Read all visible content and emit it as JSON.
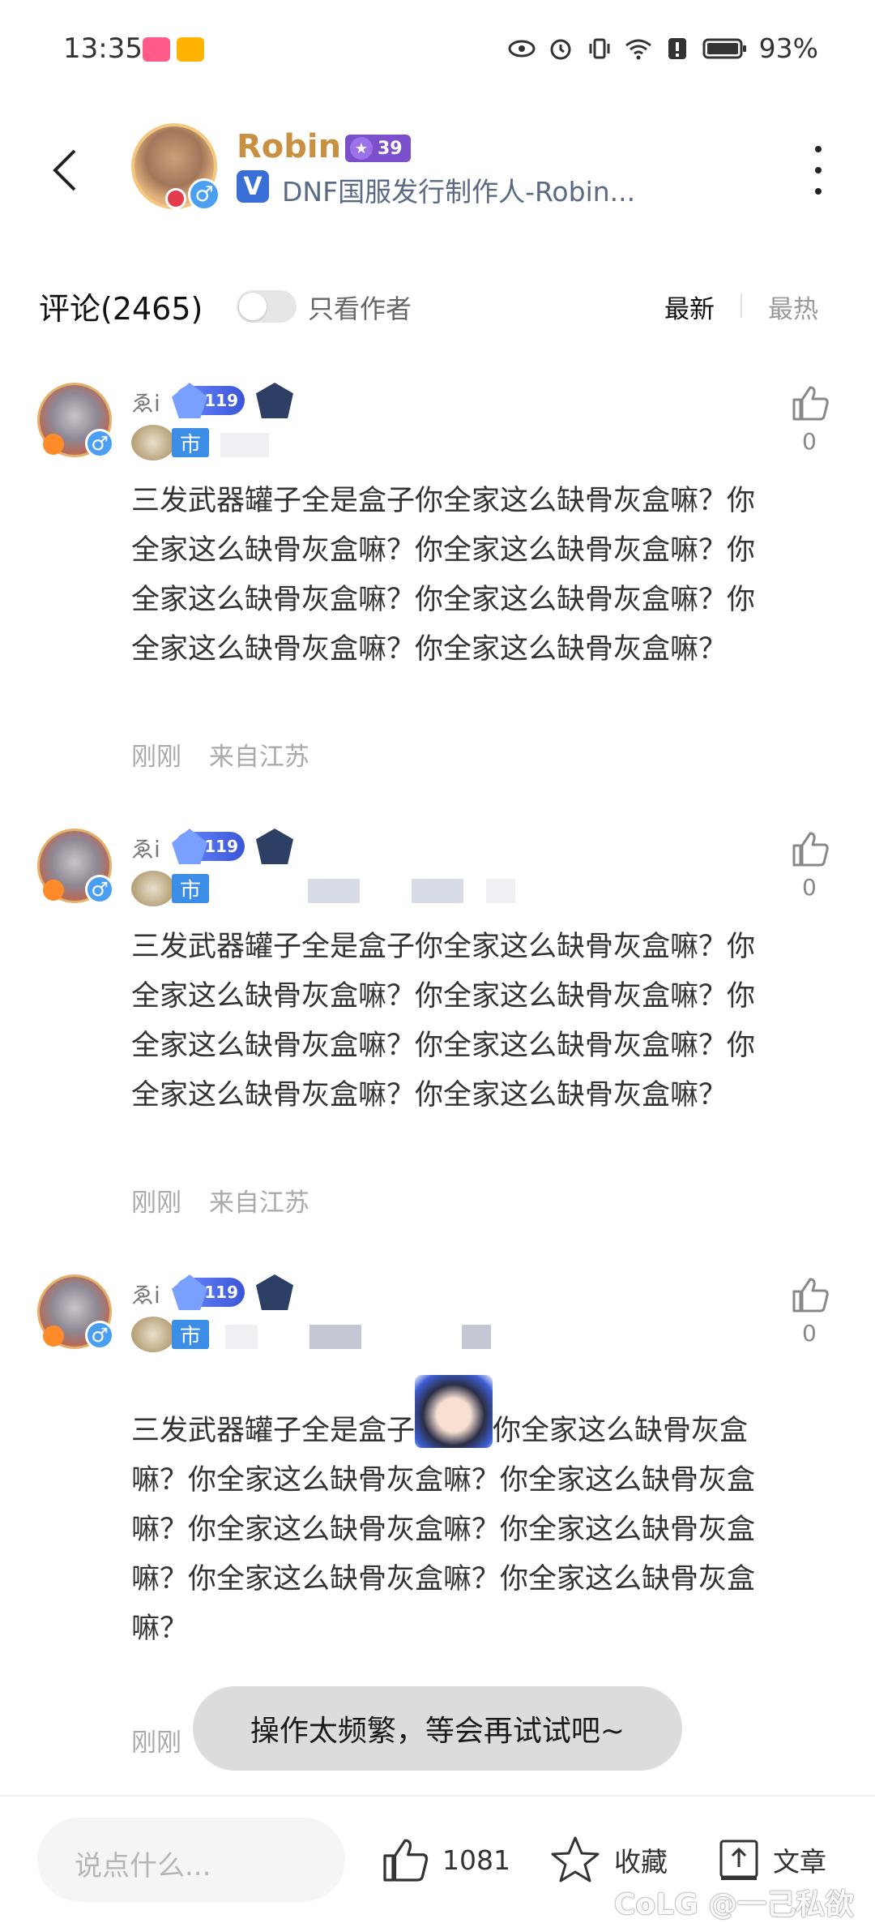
{
  "status_bar": {
    "time": "13:35",
    "battery": "93%",
    "icons": [
      "eye-icon",
      "alarm-icon",
      "vibrate-icon",
      "wifi-icon",
      "alert-icon",
      "battery-icon"
    ]
  },
  "header": {
    "author_name": "Robin",
    "author_level": "39",
    "verified_badge": "V",
    "author_title": "DNF国服发行制作人-Robin..."
  },
  "comments_bar": {
    "title": "评论(2465)",
    "only_author_label": "只看作者",
    "sort_newest": "最新",
    "sort_hottest": "最热"
  },
  "comments": [
    {
      "username": "ゑi",
      "level": "119",
      "city_tag": "市",
      "like_count": "0",
      "text": "三发武器罐子全是盒子你全家这么缺骨灰盒嘛？你全家这么缺骨灰盒嘛？你全家这么缺骨灰盒嘛？你全家这么缺骨灰盒嘛？你全家这么缺骨灰盒嘛？你全家这么缺骨灰盒嘛？你全家这么缺骨灰盒嘛？",
      "time": "刚刚",
      "location": "来自江苏"
    },
    {
      "username": "ゑi",
      "level": "119",
      "city_tag": "市",
      "like_count": "0",
      "text": "三发武器罐子全是盒子你全家这么缺骨灰盒嘛？你全家这么缺骨灰盒嘛？你全家这么缺骨灰盒嘛？你全家这么缺骨灰盒嘛？你全家这么缺骨灰盒嘛？你全家这么缺骨灰盒嘛？你全家这么缺骨灰盒嘛？",
      "time": "刚刚",
      "location": "来自江苏"
    },
    {
      "username": "ゑi",
      "level": "119",
      "city_tag": "市",
      "like_count": "0",
      "text_before": "三发武器罐子全是盒子",
      "text_after": "你全家这么缺骨灰盒嘛？你全家这么缺骨灰盒嘛？你全家这么缺骨灰盒嘛？你全家这么缺骨灰盒嘛？你全家这么缺骨灰盒嘛？你全家这么缺骨灰盒嘛？你全家这么缺骨灰盒嘛？",
      "time": "刚刚"
    }
  ],
  "toast": "操作太频繁，等会再试试吧~",
  "bottom_bar": {
    "input_placeholder": "说点什么...",
    "like_count": "1081",
    "favorite_label": "收藏",
    "article_label": "文章"
  },
  "watermark": "CoLG @一己私欲"
}
